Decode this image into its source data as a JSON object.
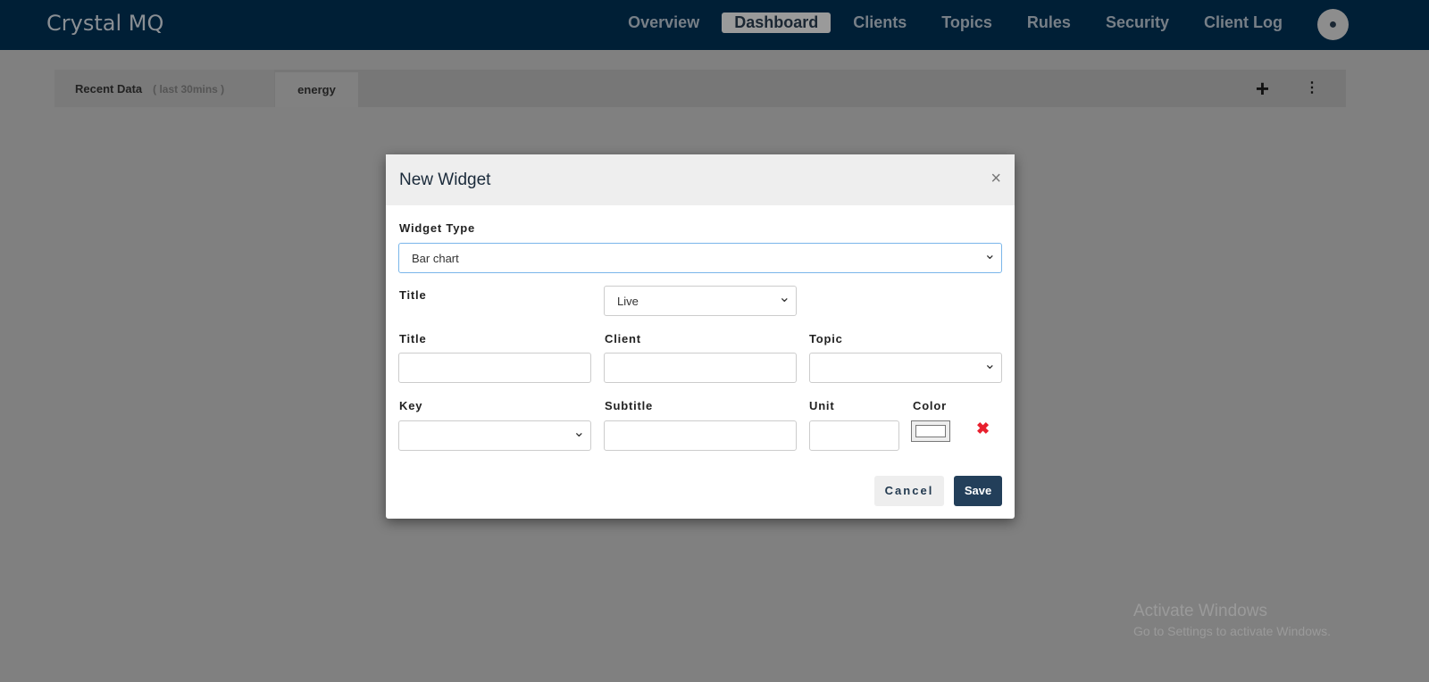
{
  "nav": {
    "logo": "Crystal MQ",
    "items": [
      "Overview",
      "Dashboard",
      "Clients",
      "Topics",
      "Rules",
      "Security",
      "Client Log"
    ],
    "active": "Dashboard"
  },
  "tabs": {
    "recent_label": "Recent Data",
    "recent_sub": "( last 30mins )",
    "energy": "energy",
    "add": "+",
    "more": "⋮"
  },
  "modal": {
    "title": "New Widget",
    "close": "×",
    "widget_type_label": "Widget Type",
    "widget_type_value": "Bar chart",
    "title_label": "Title",
    "mode_value": "Live",
    "title2_label": "Title",
    "client_label": "Client",
    "topic_label": "Topic",
    "key_label": "Key",
    "subtitle_label": "Subtitle",
    "unit_label": "Unit",
    "color_label": "Color",
    "delete": "✖",
    "cancel": "Cancel",
    "save": "Save"
  },
  "watermark": {
    "line1": "Activate Windows",
    "line2": "Go to Settings to activate Windows."
  }
}
